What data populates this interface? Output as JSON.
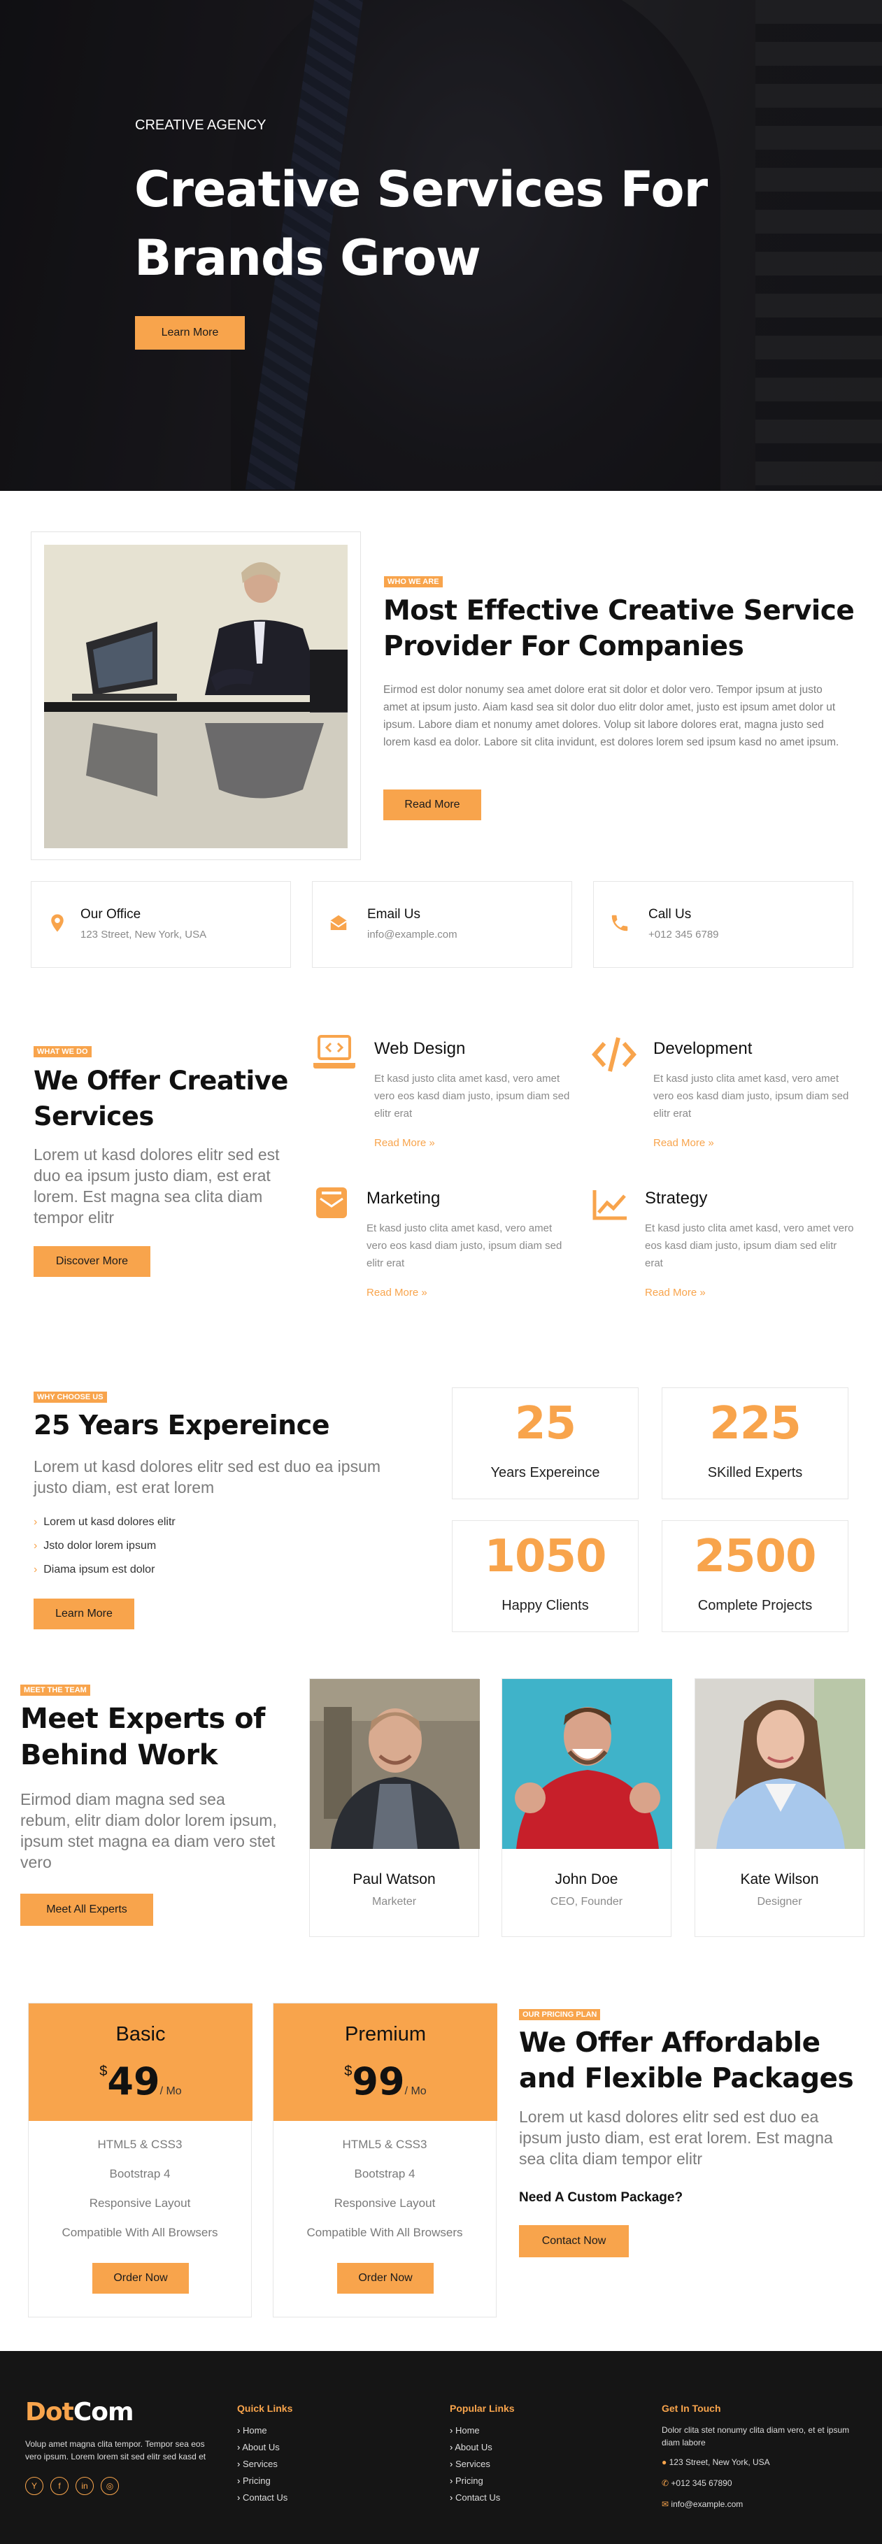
{
  "hero": {
    "eyebrow": "CREATIVE AGENCY",
    "title_line1": "Creative Services For",
    "title_line2": "Brands Grow",
    "cta": "Learn More"
  },
  "about": {
    "tag": "WHO WE ARE",
    "title_line1": "Most Effective Creative Service",
    "title_line2": "Provider For Companies",
    "text": "Eirmod est dolor nonumy sea amet dolore erat sit dolor et dolor vero. Tempor ipsum at justo amet at ipsum justo. Aiam kasd sea sit dolor duo elitr dolor amet, justo est ipsum amet dolor ut ipsum. Labore diam et nonumy amet dolores. Volup sit labore dolores erat, magna justo sed lorem kasd ea dolor. Labore sit clita invidunt, est dolores lorem sed ipsum kasd no amet ipsum.",
    "cta": "Read More"
  },
  "contacts": [
    {
      "title": "Our Office",
      "value": "123 Street, New York, USA",
      "icon": "location-pin-icon"
    },
    {
      "title": "Email Us",
      "value": "info@example.com",
      "icon": "envelope-icon"
    },
    {
      "title": "Call Us",
      "value": "+012 345 6789",
      "icon": "phone-icon"
    }
  ],
  "services": {
    "tag": "WHAT WE DO",
    "title_line1": "We Offer Creative",
    "title_line2": "Services",
    "text": "Lorem ut kasd dolores elitr sed est duo ea ipsum justo diam, est erat lorem. Est magna sea clita diam tempor elitr",
    "cta": "Discover More",
    "items": [
      {
        "title": "Web Design",
        "desc": "Et kasd justo clita amet kasd, vero amet vero eos kasd diam justo, ipsum diam sed elitr erat",
        "more": "Read More",
        "icon": "laptop-code-icon"
      },
      {
        "title": "Development",
        "desc": "Et kasd justo clita amet kasd, vero amet vero eos kasd diam justo, ipsum diam sed elitr erat",
        "more": "Read More",
        "icon": "code-icon"
      },
      {
        "title": "Marketing",
        "desc": "Et kasd justo clita amet kasd, vero amet vero eos kasd diam justo, ipsum diam sed elitr erat",
        "more": "Read More",
        "icon": "mail-bulk-icon"
      },
      {
        "title": "Strategy",
        "desc": "Et kasd justo clita amet kasd, vero amet vero eos kasd diam justo, ipsum diam sed elitr erat",
        "more": "Read More",
        "icon": "chart-line-icon"
      }
    ]
  },
  "why": {
    "tag": "WHY CHOOSE US",
    "title": "25 Years Expereince",
    "text": "Lorem ut kasd dolores elitr sed est duo ea ipsum justo diam, est erat lorem",
    "list": [
      "Lorem ut kasd dolores elitr",
      "Jsto dolor lorem ipsum",
      "Diama ipsum est dolor"
    ],
    "cta": "Learn More",
    "stats": [
      {
        "num": "25",
        "label": "Years Expereince"
      },
      {
        "num": "225",
        "label": "SKilled Experts"
      },
      {
        "num": "1050",
        "label": "Happy Clients"
      },
      {
        "num": "2500",
        "label": "Complete Projects"
      }
    ]
  },
  "team": {
    "tag": "MEET THE TEAM",
    "title_line1": "Meet Experts of",
    "title_line2": "Behind Work",
    "text": "Eirmod diam magna sed sea rebum, elitr diam dolor lorem ipsum, ipsum stet magna ea diam vero stet vero",
    "cta": "Meet All Experts",
    "members": [
      {
        "name": "Paul Watson",
        "role": "Marketer"
      },
      {
        "name": "John Doe",
        "role": "CEO, Founder"
      },
      {
        "name": "Kate Wilson",
        "role": "Designer"
      }
    ]
  },
  "pricing": {
    "tag": "OUR PRICING PLAN",
    "title_line1": "We Offer Affordable",
    "title_line2": "and Flexible Packages",
    "text": "Lorem ut kasd dolores elitr sed est duo ea ipsum justo diam, est erat lorem. Est magna sea clita diam tempor elitr",
    "custom": "Need A Custom Package?",
    "cta": "Contact Now",
    "plans": [
      {
        "name": "Basic",
        "currency": "$",
        "price": "49",
        "period": "/ Mo",
        "features": [
          "HTML5 & CSS3",
          "Bootstrap 4",
          "Responsive Layout",
          "Compatible With All Browsers"
        ],
        "cta": "Order Now"
      },
      {
        "name": "Premium",
        "currency": "$",
        "price": "99",
        "period": "/ Mo",
        "features": [
          "HTML5 & CSS3",
          "Bootstrap 4",
          "Responsive Layout",
          "Compatible With All Browsers"
        ],
        "cta": "Order Now"
      }
    ]
  },
  "footer": {
    "logo_a": "Dot",
    "logo_b": "Com",
    "about": "Volup amet magna clita tempor. Tempor sea eos vero ipsum. Lorem lorem sit sed elitr sed kasd et",
    "social": [
      "Y",
      "f",
      "in",
      "◎"
    ],
    "quick_title": "Quick Links",
    "quick": [
      "Home",
      "About Us",
      "Services",
      "Pricing",
      "Contact Us"
    ],
    "popular_title": "Popular Links",
    "popular": [
      "Home",
      "About Us",
      "Services",
      "Pricing",
      "Contact Us"
    ],
    "touch_title": "Get In Touch",
    "touch_text": "Dolor clita stet nonumy clita diam vero, et et ipsum diam labore",
    "address": "123 Street, New York, USA",
    "phone": "+012 345 67890",
    "email": "info@example.com"
  },
  "colors": {
    "accent": "#f8a44c",
    "dark": "#151515"
  }
}
